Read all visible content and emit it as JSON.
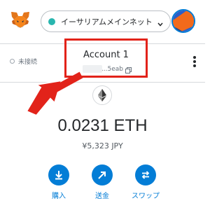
{
  "network": {
    "label": "イーサリアムメインネット",
    "status_color": "#29b6af"
  },
  "header": {
    "connection_status": "未接続",
    "account_name": "Account 1",
    "address_suffix": "...5eab"
  },
  "asset": {
    "balance": "0.0231 ETH",
    "fiat": "¥5,323 JPY"
  },
  "actions": [
    {
      "label": "購入",
      "icon": "download-icon"
    },
    {
      "label": "送金",
      "icon": "arrow-up-right-icon"
    },
    {
      "label": "スワップ",
      "icon": "swap-icon"
    }
  ],
  "colors": {
    "accent": "#037dd6",
    "highlight": "#e2231a",
    "text": "#24272a"
  }
}
